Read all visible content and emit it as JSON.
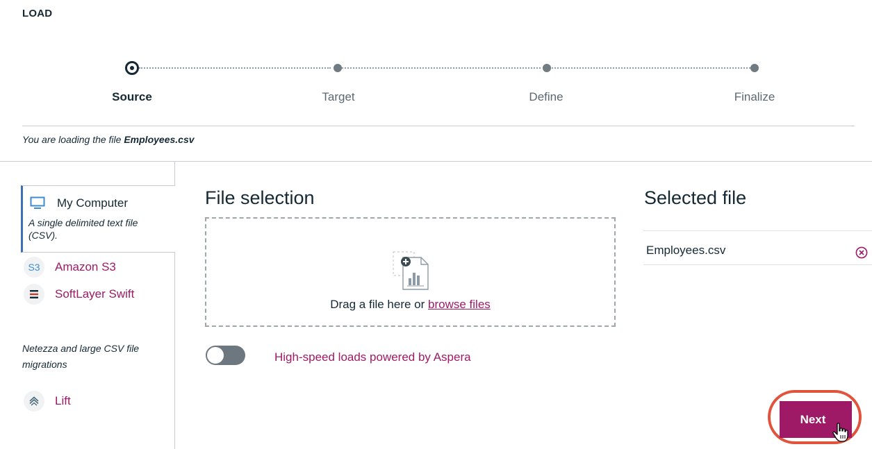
{
  "page": {
    "title": "LOAD"
  },
  "stepper": {
    "steps": [
      {
        "label": "Source",
        "active": true
      },
      {
        "label": "Target",
        "active": false
      },
      {
        "label": "Define",
        "active": false
      },
      {
        "label": "Finalize",
        "active": false
      }
    ]
  },
  "loading_message": {
    "prefix": "You are loading the file ",
    "filename": "Employees.csv"
  },
  "sidebar": {
    "sources": [
      {
        "name": "My Computer",
        "icon": "monitor-icon",
        "description": "A single delimited text file (CSV).",
        "selected": true
      },
      {
        "name": "Amazon S3",
        "icon": "s3-icon",
        "glyph": "S3"
      },
      {
        "name": "SoftLayer Swift",
        "icon": "softlayer-icon"
      }
    ],
    "migration_note": "Netezza and large CSV file migrations",
    "lift": {
      "name": "Lift",
      "icon": "lift-icon"
    }
  },
  "file_selection": {
    "title": "File selection",
    "drop_text": "Drag a file here or ",
    "browse_label": "browse files",
    "aspera_label": "High-speed loads powered by Aspera",
    "aspera_enabled": false
  },
  "selected_file": {
    "title": "Selected file",
    "filename": "Employees.csv"
  },
  "actions": {
    "next_label": "Next"
  },
  "colors": {
    "accent": "#9e1a66",
    "highlight": "#e0533c",
    "text": "#152935",
    "active_tab": "#3d70b2"
  }
}
